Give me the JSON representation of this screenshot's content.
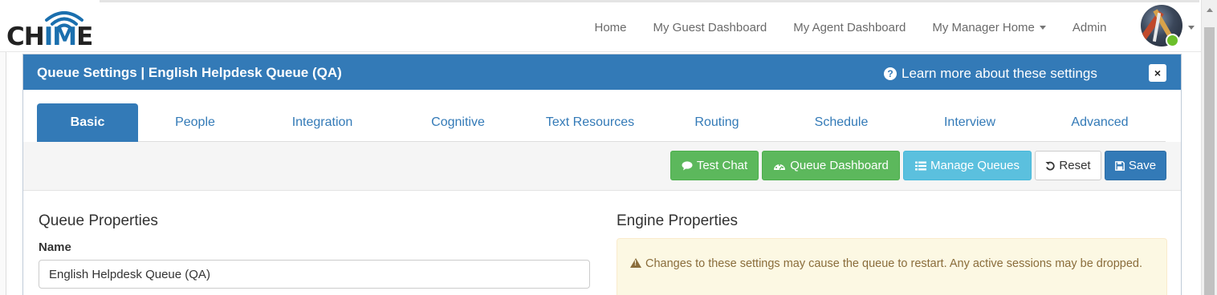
{
  "navbar": {
    "logo_text_a": "CH",
    "logo_text_b": "IM",
    "logo_text_c": "E",
    "links": [
      {
        "label": "Home"
      },
      {
        "label": "My Guest Dashboard"
      },
      {
        "label": "My Agent Dashboard"
      },
      {
        "label": "My Manager Home",
        "has_caret": true
      },
      {
        "label": "Admin"
      }
    ],
    "user_status_color": "#6bbf2a"
  },
  "modal": {
    "title": "Queue Settings | English Helpdesk Queue (QA)",
    "help_icon": "question-circle-icon",
    "learn_more": "Learn more about these settings",
    "close_symbol": "×",
    "header_color": "#337ab7"
  },
  "tabs": [
    {
      "label": "Basic",
      "active": true
    },
    {
      "label": "People"
    },
    {
      "label": "Integration"
    },
    {
      "label": "Cognitive"
    },
    {
      "label": "Text Resources"
    },
    {
      "label": "Routing"
    },
    {
      "label": "Schedule"
    },
    {
      "label": "Interview"
    },
    {
      "label": "Advanced"
    }
  ],
  "toolbar": {
    "test_chat": "Test Chat",
    "queue_dashboard": "Queue Dashboard",
    "manage_queues": "Manage Queues",
    "reset": "Reset",
    "save": "Save"
  },
  "queue_properties": {
    "heading": "Queue Properties",
    "name_label": "Name",
    "name_value": "English Helpdesk Queue (QA)"
  },
  "engine_properties": {
    "heading": "Engine Properties",
    "warning": "Changes to these settings may cause the queue to restart. Any active sessions may be dropped."
  }
}
